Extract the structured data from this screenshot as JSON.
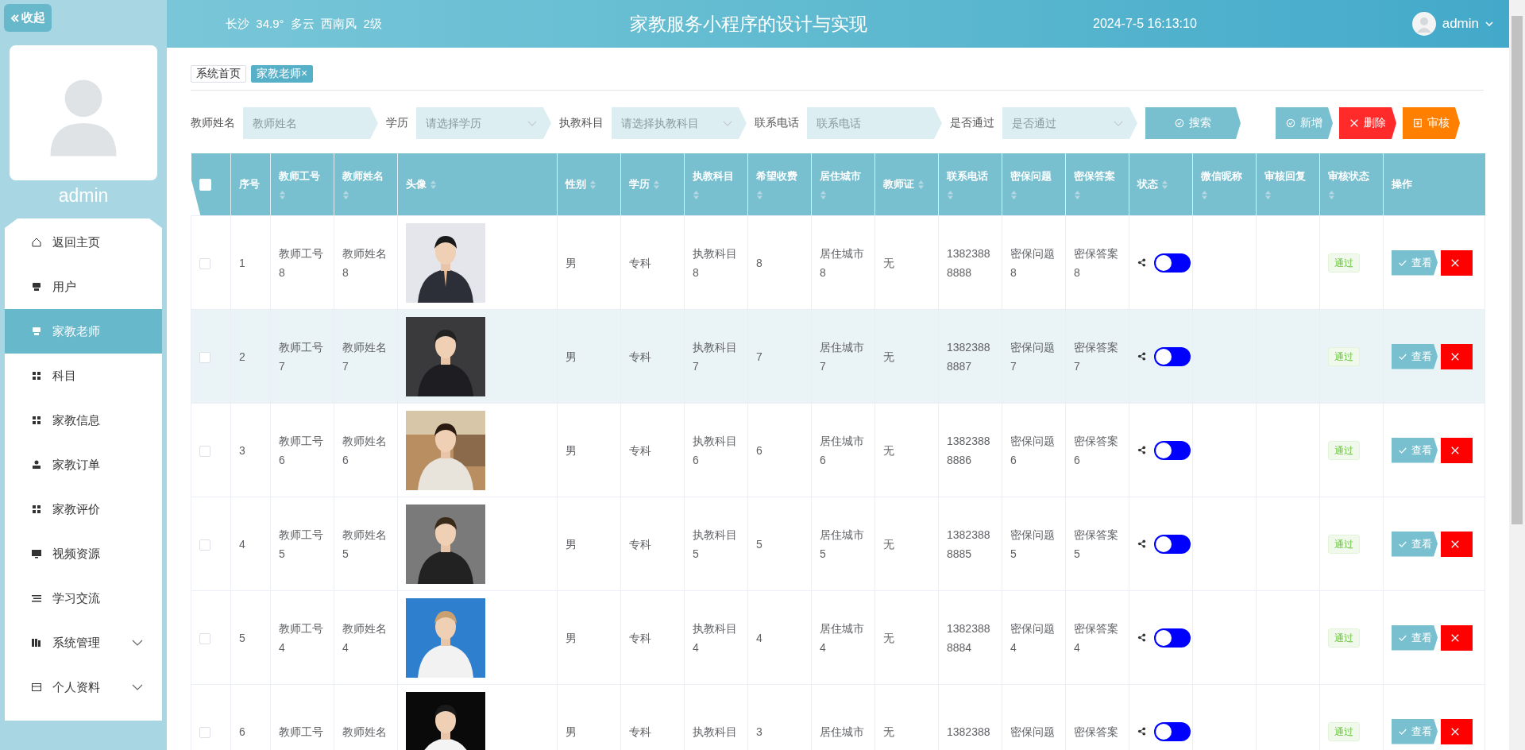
{
  "sidebar": {
    "collapse_label": "收起",
    "username": "admin",
    "items": [
      {
        "label": "返回主页",
        "selected": false,
        "expandable": false
      },
      {
        "label": "用户",
        "selected": false,
        "expandable": false
      },
      {
        "label": "家教老师",
        "selected": true,
        "expandable": false
      },
      {
        "label": "科目",
        "selected": false,
        "expandable": false
      },
      {
        "label": "家教信息",
        "selected": false,
        "expandable": false
      },
      {
        "label": "家教订单",
        "selected": false,
        "expandable": false
      },
      {
        "label": "家教评价",
        "selected": false,
        "expandable": false
      },
      {
        "label": "视频资源",
        "selected": false,
        "expandable": false
      },
      {
        "label": "学习交流",
        "selected": false,
        "expandable": false
      },
      {
        "label": "系统管理",
        "selected": false,
        "expandable": true
      },
      {
        "label": "个人资料",
        "selected": false,
        "expandable": true
      }
    ]
  },
  "header": {
    "weather": "长沙  34.9°  多云  西南风  2级",
    "title": "家教服务小程序的设计与实现",
    "datetime": "2024-7-5 16:13:10",
    "user": "admin"
  },
  "breadcrumb": [
    {
      "label": "系统首页",
      "selected": false
    },
    {
      "label": "家教老师×",
      "selected": true
    }
  ],
  "filters": [
    {
      "kind": "input",
      "label": "教师姓名",
      "placeholder": "教师姓名"
    },
    {
      "kind": "select",
      "label": "学历",
      "placeholder": "请选择学历"
    },
    {
      "kind": "select",
      "label": "执教科目",
      "placeholder": "请选择执教科目"
    },
    {
      "kind": "input",
      "label": "联系电话",
      "placeholder": "联系电话"
    },
    {
      "kind": "select",
      "label": "是否通过",
      "placeholder": "是否通过"
    }
  ],
  "search_button": "搜索",
  "actions": [
    {
      "kind": "add",
      "label": "新增"
    },
    {
      "kind": "delete",
      "label": "删除"
    },
    {
      "kind": "audit",
      "label": "审核"
    }
  ],
  "table": {
    "all_checked": false,
    "columns": [
      {
        "label": "序号",
        "sortable": false
      },
      {
        "label": "教师工号",
        "sortable": true
      },
      {
        "label": "教师姓名",
        "sortable": true
      },
      {
        "label": "头像",
        "sortable": true
      },
      {
        "label": "性别",
        "sortable": true
      },
      {
        "label": "学历",
        "sortable": true
      },
      {
        "label": "执教科目",
        "sortable": true
      },
      {
        "label": "希望收费",
        "sortable": true
      },
      {
        "label": "居住城市",
        "sortable": true
      },
      {
        "label": "教师证",
        "sortable": true
      },
      {
        "label": "联系电话",
        "sortable": true
      },
      {
        "label": "密保问题",
        "sortable": true
      },
      {
        "label": "密保答案",
        "sortable": true
      },
      {
        "label": "状态",
        "sortable": true
      },
      {
        "label": "微信昵称",
        "sortable": true
      },
      {
        "label": "审核回复",
        "sortable": true
      },
      {
        "label": "审核状态",
        "sortable": true
      },
      {
        "label": "操作",
        "sortable": false
      }
    ],
    "rows": [
      {
        "checked": false,
        "hovered": false,
        "index": "1",
        "teacher_no": [
          "教师工号",
          "8"
        ],
        "name": [
          "教师姓名",
          "8"
        ],
        "photo": {
          "kind": "picture"
        },
        "gender": "男",
        "education": "专科",
        "subject": [
          "执教科目",
          "8"
        ],
        "fee": "8",
        "city": [
          "居住城市",
          "8"
        ],
        "certificate": "无",
        "phone": [
          "1382388",
          "8888"
        ],
        "question": [
          "密保问题",
          "8"
        ],
        "answer": [
          "密保答案",
          "8"
        ],
        "on": false,
        "audit": "通过",
        "view": "查看"
      },
      {
        "checked": false,
        "hovered": true,
        "index": "2",
        "teacher_no": [
          "教师工号",
          "7"
        ],
        "name": [
          "教师姓名",
          "7"
        ],
        "photo": {
          "kind": "picture"
        },
        "gender": "男",
        "education": "专科",
        "subject": [
          "执教科目",
          "7"
        ],
        "fee": "7",
        "city": [
          "居住城市",
          "7"
        ],
        "certificate": "无",
        "phone": [
          "1382388",
          "8887"
        ],
        "question": [
          "密保问题",
          "7"
        ],
        "answer": [
          "密保答案",
          "7"
        ],
        "on": false,
        "audit": "通过",
        "view": "查看"
      },
      {
        "checked": false,
        "hovered": false,
        "index": "3",
        "teacher_no": [
          "教师工号",
          "6"
        ],
        "name": [
          "教师姓名",
          "6"
        ],
        "photo": {
          "kind": "picture"
        },
        "gender": "男",
        "education": "专科",
        "subject": [
          "执教科目",
          "6"
        ],
        "fee": "6",
        "city": [
          "居住城市",
          "6"
        ],
        "certificate": "无",
        "phone": [
          "1382388",
          "8886"
        ],
        "question": [
          "密保问题",
          "6"
        ],
        "answer": [
          "密保答案",
          "6"
        ],
        "on": false,
        "audit": "通过",
        "view": "查看"
      },
      {
        "checked": false,
        "hovered": false,
        "index": "4",
        "teacher_no": [
          "教师工号",
          "5"
        ],
        "name": [
          "教师姓名",
          "5"
        ],
        "photo": {
          "kind": "picture"
        },
        "gender": "男",
        "education": "专科",
        "subject": [
          "执教科目",
          "5"
        ],
        "fee": "5",
        "city": [
          "居住城市",
          "5"
        ],
        "certificate": "无",
        "phone": [
          "1382388",
          "8885"
        ],
        "question": [
          "密保问题",
          "5"
        ],
        "answer": [
          "密保答案",
          "5"
        ],
        "on": false,
        "audit": "通过",
        "view": "查看"
      },
      {
        "checked": false,
        "hovered": false,
        "index": "5",
        "teacher_no": [
          "教师工号",
          "4"
        ],
        "name": [
          "教师姓名",
          "4"
        ],
        "photo": {
          "kind": "picture"
        },
        "gender": "男",
        "education": "专科",
        "subject": [
          "执教科目",
          "4"
        ],
        "fee": "4",
        "city": [
          "居住城市",
          "4"
        ],
        "certificate": "无",
        "phone": [
          "1382388",
          "8884"
        ],
        "question": [
          "密保问题",
          "4"
        ],
        "answer": [
          "密保答案",
          "4"
        ],
        "on": false,
        "audit": "通过",
        "view": "查看"
      },
      {
        "checked": false,
        "hovered": false,
        "index": "6",
        "teacher_no": [
          "教师工号"
        ],
        "name": [
          "教师姓名"
        ],
        "photo": {
          "kind": "picture"
        },
        "gender": "男",
        "education": "专科",
        "subject": [
          "执教科目"
        ],
        "fee": "3",
        "city": [
          "居住城市"
        ],
        "certificate": "无",
        "phone": [
          "1382388"
        ],
        "question": [
          "密保问题"
        ],
        "answer": [
          "密保答案"
        ],
        "on": false,
        "audit": "通过",
        "view": "查看"
      }
    ]
  }
}
